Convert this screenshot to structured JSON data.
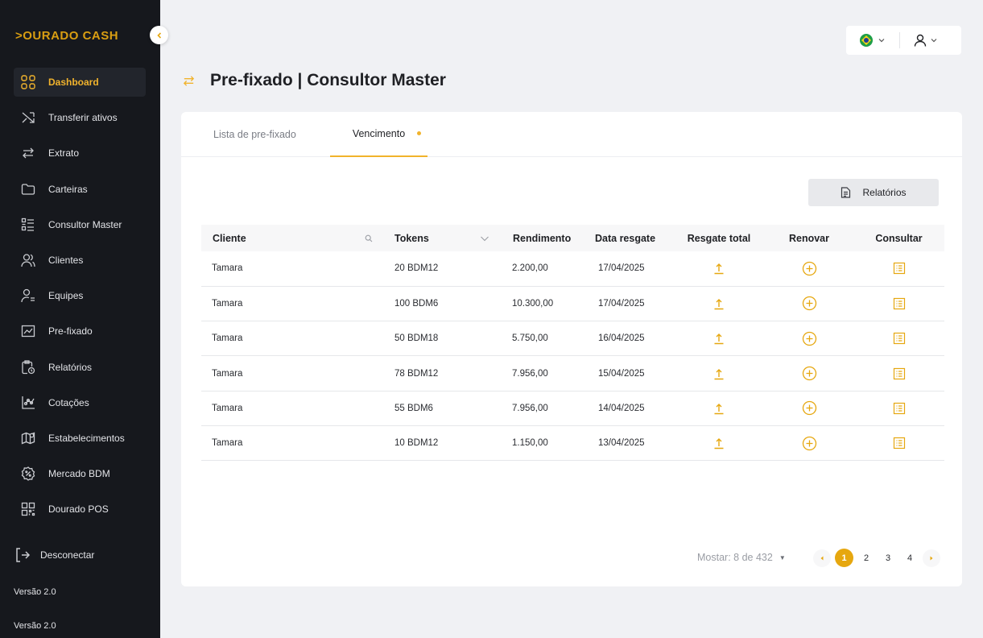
{
  "brand": {
    "logo_text": ">OURADO CASH",
    "accent": "#f1b32c"
  },
  "sidebar": {
    "items": [
      {
        "label": "Dashboard",
        "icon": "grid-icon",
        "active": true
      },
      {
        "label": "Transferir ativos",
        "icon": "shuffle-icon"
      },
      {
        "label": "Extrato",
        "icon": "swap-arrows-icon"
      },
      {
        "label": "Carteiras",
        "icon": "folder-icon"
      },
      {
        "label": "Consultor Master",
        "icon": "list-checks-icon"
      },
      {
        "label": "Clientes",
        "icon": "users-icon"
      },
      {
        "label": "Equipes",
        "icon": "user-list-icon"
      },
      {
        "label": "Pre-fixado",
        "icon": "chart-line-icon"
      },
      {
        "label": "Relatórios",
        "icon": "clipboard-clock-icon"
      },
      {
        "label": "Cotações",
        "icon": "scatter-chart-icon"
      },
      {
        "label": "Estabelecimentos",
        "icon": "map-pin-icon"
      },
      {
        "label": "Mercado BDM",
        "icon": "percent-badge-icon"
      },
      {
        "label": "Dourado POS",
        "icon": "qr-code-icon"
      }
    ],
    "logout_label": "Desconectar",
    "version_1": "Versão 2.0",
    "version_2": "Versão 2.0"
  },
  "page": {
    "title": "Pre-fixado | Consultor Master"
  },
  "tabs": [
    {
      "label": "Lista de pre-fixado",
      "active": false
    },
    {
      "label": "Vencimento",
      "active": true
    }
  ],
  "reports_button": "Relatórios",
  "table": {
    "headers": {
      "cliente": "Cliente",
      "tokens": "Tokens",
      "rendimento": "Rendimento",
      "data_resgate": "Data resgate",
      "resgate_total": "Resgate total",
      "renovar": "Renovar",
      "consultar": "Consultar"
    },
    "rows": [
      {
        "cliente": "Tamara",
        "tokens": "20 BDM12",
        "rendimento": "2.200,00",
        "data": "17/04/2025"
      },
      {
        "cliente": "Tamara",
        "tokens": "100 BDM6",
        "rendimento": "10.300,00",
        "data": "17/04/2025"
      },
      {
        "cliente": "Tamara",
        "tokens": "50 BDM18",
        "rendimento": "5.750,00",
        "data": "16/04/2025"
      },
      {
        "cliente": "Tamara",
        "tokens": "78 BDM12",
        "rendimento": "7.956,00",
        "data": "15/04/2025"
      },
      {
        "cliente": "Tamara",
        "tokens": "55 BDM6",
        "rendimento": "7.956,00",
        "data": "14/04/2025"
      },
      {
        "cliente": "Tamara",
        "tokens": "10 BDM12",
        "rendimento": "1.150,00",
        "data": "13/04/2025"
      }
    ]
  },
  "pagination": {
    "show_label": "Mostar: 8 de 432",
    "pages": [
      "1",
      "2",
      "3",
      "4"
    ],
    "current": "1"
  }
}
